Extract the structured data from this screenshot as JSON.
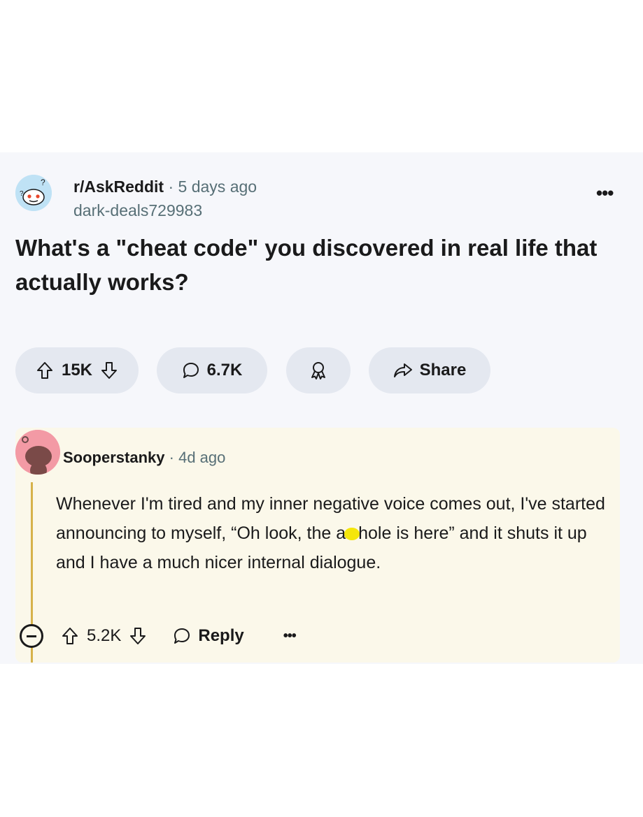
{
  "post": {
    "subreddit": "r/AskReddit",
    "separator": "·",
    "time": "5 days ago",
    "author": "dark-deals729983",
    "more": "•••",
    "title": "What's a \"cheat code\" you discovered in real life that actually works?",
    "votes": "15K",
    "comments": "6.7K",
    "share_label": "Share"
  },
  "comment": {
    "username": "Sooperstanky",
    "separator": "·",
    "time": "4d ago",
    "body_before": "Whenever I'm tired and my inner negative voice comes out, I've started announcing to myself, “Oh look, the a",
    "body_after": "hole is here” and it shuts it up and I have a much nicer internal dialogue.",
    "votes": "5.2K",
    "reply_label": "Reply",
    "more": "•••"
  },
  "colors": {
    "card_bg": "#f6f7fb",
    "pill_bg": "#e4e8f0",
    "comment_bg": "#fbf8ea",
    "thread_line": "#d6b24a",
    "censor": "#f5e60a"
  },
  "icons": {
    "upvote": "arrow-up-icon",
    "downvote": "arrow-down-icon",
    "comment": "speech-bubble-icon",
    "award": "award-icon",
    "share": "share-arrow-icon",
    "collapse": "minus-circle-icon"
  }
}
